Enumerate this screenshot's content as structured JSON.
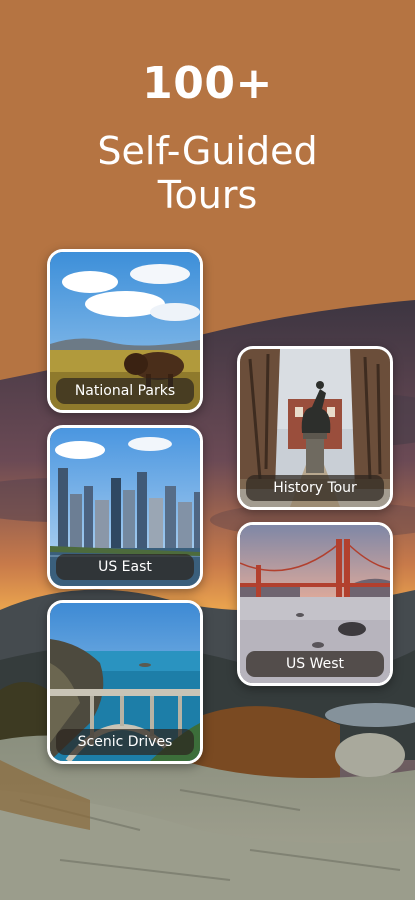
{
  "header": {
    "count": "100+",
    "title_line1": "Self-Guided",
    "title_line2": "Tours"
  },
  "tours": [
    {
      "label": "National Parks",
      "photo": "bison-in-grassland"
    },
    {
      "label": "History Tour",
      "photo": "equestrian-statue-in-park"
    },
    {
      "label": "US East",
      "photo": "new-york-skyline"
    },
    {
      "label": "US West",
      "photo": "golden-gate-bridge"
    },
    {
      "label": "Scenic Drives",
      "photo": "coastal-highway-bridge"
    }
  ],
  "colors": {
    "header_bg": "#b57442",
    "text": "#ffffff",
    "card_border": "#ffffff",
    "label_bg": "#2d261e"
  }
}
